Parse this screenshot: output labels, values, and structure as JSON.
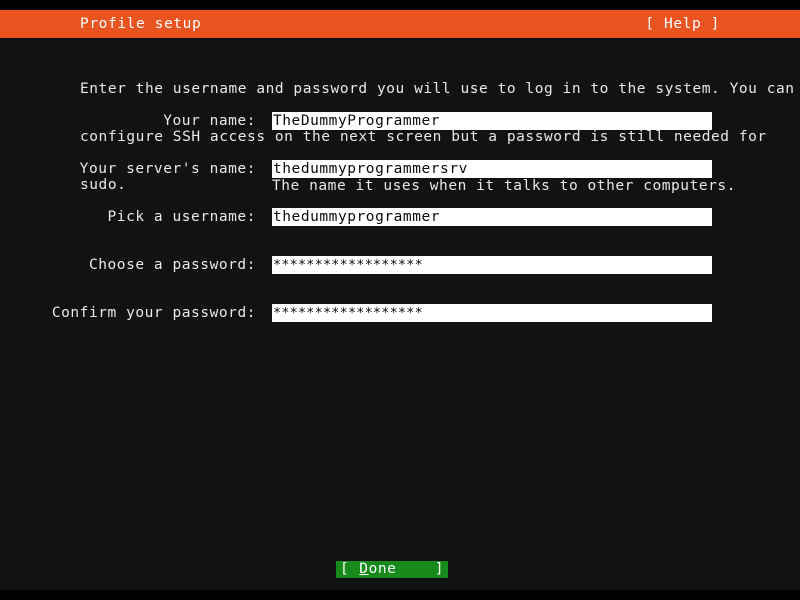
{
  "screen": {
    "title": "Profile setup",
    "colors": {
      "header_background": "#e95420",
      "terminal_background": "#121212",
      "text": "#e8e8e8",
      "input_background": "#ffffff",
      "input_text": "#0b0b0b",
      "button_background": "#188a1c",
      "button_text": "#ffffff"
    }
  },
  "header": {
    "title": "Profile setup",
    "help_label": "[ Help ]"
  },
  "description": {
    "line1": "Enter the username and password you will use to log in to the system. You can",
    "line2": "configure SSH access on the next screen but a password is still needed for",
    "line3": "sudo."
  },
  "form": {
    "fields": [
      {
        "label": "Your name:",
        "value": "TheDummyProgrammer",
        "hint": "",
        "masked": false
      },
      {
        "label": "Your server's name:",
        "value": "thedummyprogrammersrv",
        "hint": "The name it uses when it talks to other computers.",
        "masked": false
      },
      {
        "label": "Pick a username:",
        "value": "thedummyprogrammer",
        "hint": "",
        "masked": false
      },
      {
        "label": "Choose a password:",
        "value": "******************",
        "hint": "",
        "masked": true
      },
      {
        "label": "Confirm your password:",
        "value": "******************",
        "hint": "",
        "masked": true
      }
    ]
  },
  "footer": {
    "done": {
      "open_bracket": "[",
      "accelerator": "D",
      "rest": "one",
      "close_bracket": "]"
    }
  }
}
